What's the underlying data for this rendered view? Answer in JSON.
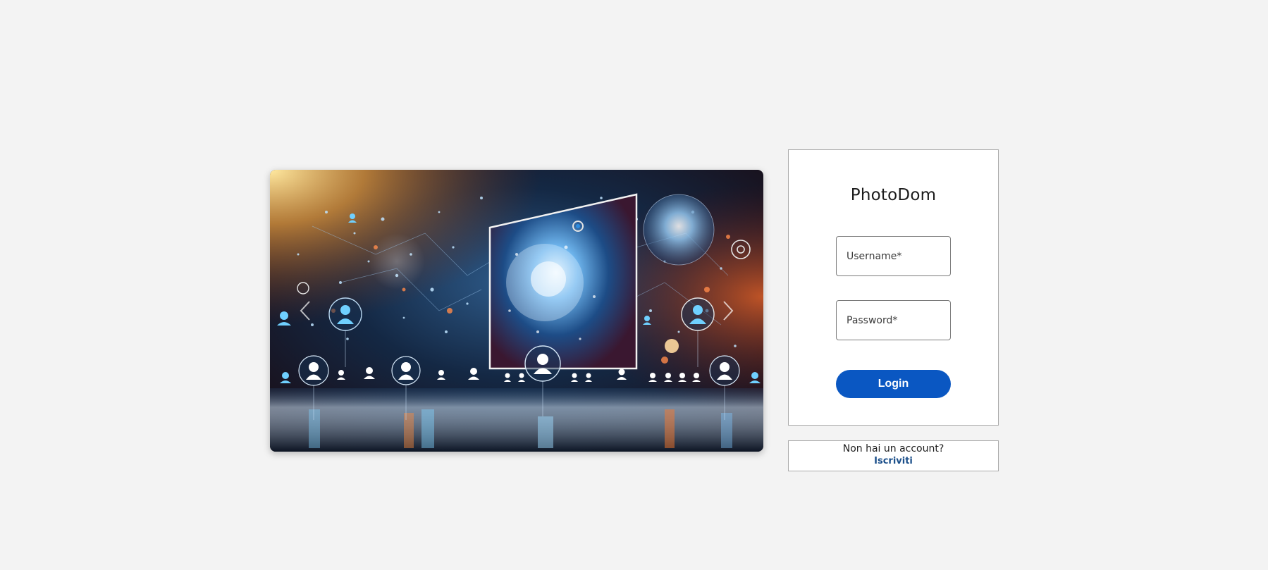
{
  "carousel": {
    "prev_icon": "chevron-left-icon",
    "next_icon": "chevron-right-icon"
  },
  "login": {
    "brand": "PhotoDom",
    "username_placeholder": "Username*",
    "password_placeholder": "Password*",
    "login_label": "Login"
  },
  "signup": {
    "prompt": "Non hai un account?",
    "link_label": "Iscriviti"
  },
  "colors": {
    "page_bg": "#f3f3f3",
    "button": "#0a57c2",
    "link": "#1b4f8a"
  }
}
